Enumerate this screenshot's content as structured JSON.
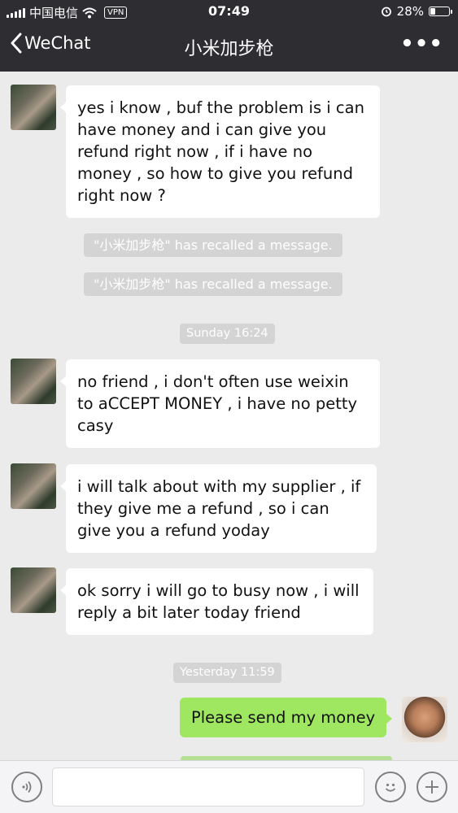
{
  "status_bar": {
    "carrier": "中国电信",
    "vpn": "VPN",
    "time": "07:49",
    "battery_text": "28%",
    "battery_level": 0.28
  },
  "nav": {
    "back_label": "WeChat",
    "title": "小米加步枪",
    "more_label": "•••"
  },
  "messages": [
    {
      "text": "yes i know , buf the problem is i can have money and i can give you refund right now , if i have no money , so how to give you refund right now ?"
    },
    {
      "text": "no friend , i don't often use weixin to aCCEPT MONEY ,    i have no petty casy"
    },
    {
      "text": "i will talk about with my supplier , if they give me a refund , so i can give you a refund yoday"
    },
    {
      "text": "ok sorry i will go to busy now , i will reply a bit later today friend"
    },
    {
      "text": "Please send my money"
    }
  ],
  "system_notices": [
    "\"小米加步枪\" has recalled a message.",
    "\"小米加步枪\" has recalled a message."
  ],
  "timestamps": [
    "Sunday 16:24",
    "Yesterday 11:59"
  ],
  "input": {
    "value": ""
  },
  "colors": {
    "header": "#2e2d32",
    "chat_background": "#ebebeb",
    "sent_bubble": "#9fe760",
    "received_bubble": "#ffffff"
  },
  "icons": {
    "back": "chevron-left-icon",
    "more": "more-icon",
    "voice": "voice-icon",
    "emoji": "emoji-icon",
    "plus": "plus-icon"
  }
}
